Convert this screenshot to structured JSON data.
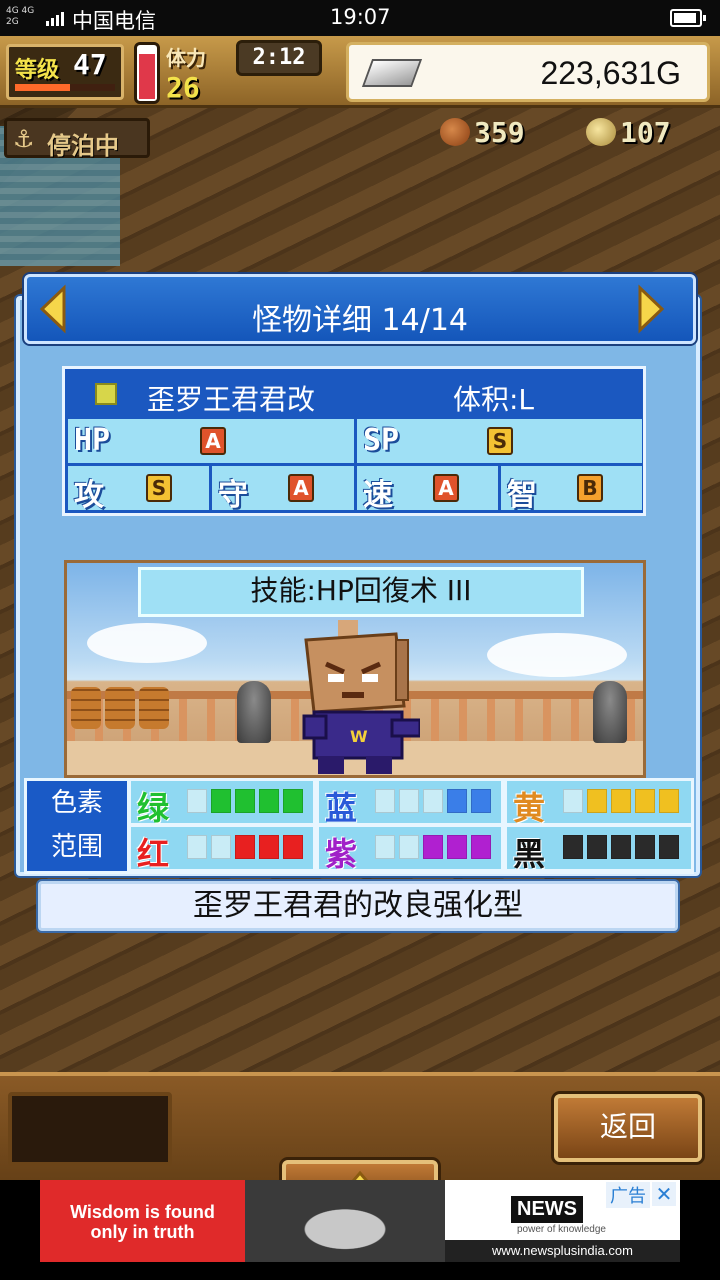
{
  "status_bar": {
    "network_top": "4G 4G",
    "network_bottom": "2G",
    "carrier": "中国电信",
    "time": "19:07",
    "battery_level": 0.8
  },
  "hud": {
    "level_label": "等级",
    "level_value": "47",
    "xp_fraction": 0.55,
    "stamina_fraction": 0.8,
    "stamina_label": "体力",
    "stamina_value": "26",
    "timer": "2:12",
    "gold": "223,631G",
    "anchor_status": "停泊中",
    "food": "359",
    "medals": "107"
  },
  "dialog": {
    "title": "怪物详细 14/14",
    "monster_name": "歪罗王君君改",
    "size": "体积:L",
    "stats": {
      "hp_label": "HP",
      "hp_grade": "A",
      "sp_label": "SP",
      "sp_grade": "S",
      "atk_label": "攻",
      "atk_grade": "S",
      "def_label": "守",
      "def_grade": "A",
      "spd_label": "速",
      "spd_grade": "A",
      "int_label": "智",
      "int_grade": "B"
    },
    "skill": "技能:HP回復术 III",
    "element_label_1": "色素",
    "element_label_2": "范围",
    "elements": {
      "green": {
        "name": "绿",
        "color": "#20c030",
        "filled": 4,
        "total": 5
      },
      "blue": {
        "name": "蓝",
        "color": "#3a7ee8",
        "filled": 2,
        "total": 5
      },
      "yellow": {
        "name": "黄",
        "color": "#f0c020",
        "filled": 4,
        "total": 5
      },
      "red": {
        "name": "红",
        "color": "#e82020",
        "filled": 3,
        "total": 5
      },
      "purple": {
        "name": "紫",
        "color": "#b020d0",
        "filled": 3,
        "total": 5
      },
      "black": {
        "name": "黑",
        "color": "#2a2a2a",
        "filled": 5,
        "total": 5
      }
    },
    "description": "歪罗王君君的改良强化型"
  },
  "buttons": {
    "back": "返回"
  },
  "ad": {
    "quote_line1": "Wisdom is found",
    "quote_line2": "only in truth",
    "news_logo": "NEWS",
    "news_tagline": "power of knowledge",
    "news_url": "www.newsplusindia.com",
    "ad_label": "广告",
    "close": "✕"
  },
  "colors": {
    "title_blue": "#1456ba",
    "panel_light_blue": "#9fe0f5",
    "wood": "#7e5a2f"
  }
}
